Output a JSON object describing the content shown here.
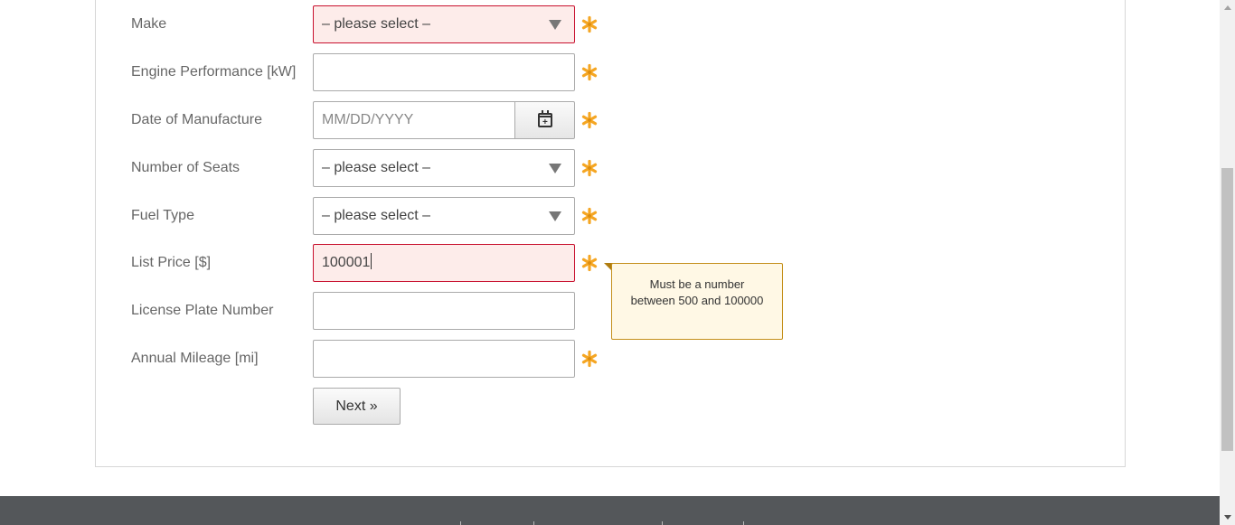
{
  "form": {
    "fields": [
      {
        "label": "Make",
        "type": "select",
        "value": "– please select –",
        "error": true,
        "required": true
      },
      {
        "label": "Engine Performance [kW]",
        "type": "text",
        "value": "",
        "error": false,
        "required": true
      },
      {
        "label": "Date of Manufacture",
        "type": "date",
        "placeholder": "MM/DD/YYYY",
        "error": false,
        "required": true
      },
      {
        "label": "Number of Seats",
        "type": "select",
        "value": "– please select –",
        "error": false,
        "required": true
      },
      {
        "label": "Fuel Type",
        "type": "select",
        "value": "– please select –",
        "error": false,
        "required": true
      },
      {
        "label": "List Price [$]",
        "type": "text",
        "value": "100001",
        "error": true,
        "required": true
      },
      {
        "label": "License Plate Number",
        "type": "text",
        "value": "",
        "error": false,
        "required": false
      },
      {
        "label": "Annual Mileage [mi]",
        "type": "text",
        "value": "",
        "error": false,
        "required": true
      }
    ],
    "next_label": "Next »"
  },
  "tooltip": {
    "message": "Must be a number between 500 and 100000"
  },
  "icons": {
    "required": "asterisk-icon",
    "calendar": "calendar-icon",
    "dropdown": "chevron-down-icon"
  },
  "colors": {
    "error_border": "#c8102e",
    "error_background": "#fdecea",
    "required_star": "#f5a623",
    "tooltip_background": "#fff8e5",
    "tooltip_border": "#c48f1a",
    "footer_background": "#54575a"
  }
}
